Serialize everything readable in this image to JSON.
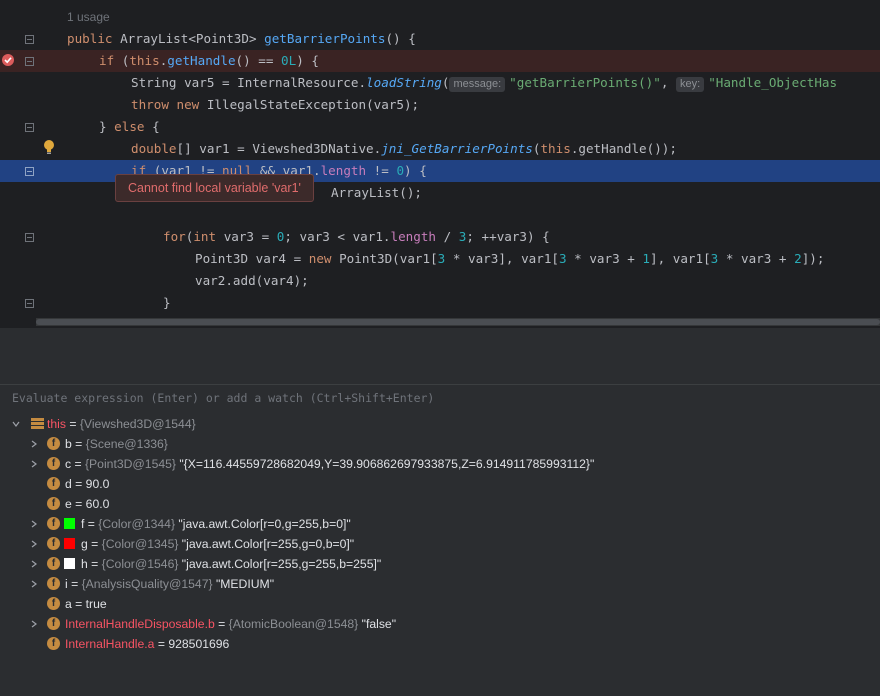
{
  "editor": {
    "usage_label": "1 usage",
    "lines": {
      "l1": {
        "kw1": "public ",
        "type": "ArrayList<Point3D> ",
        "fn": "getBarrierPoints",
        "rest": "() {"
      },
      "l2": {
        "kw1": "if ",
        "p1": "(",
        "kw2": "this",
        "p2": ".",
        "fn": "getHandle",
        "p3": "() == ",
        "num": "0L",
        "p4": ") {"
      },
      "l3": {
        "p1": "String var5 = InternalResource.",
        "fn": "loadString",
        "p2": "(",
        "hint1": "message:",
        "str1": "\"getBarrierPoints()\"",
        "p3": ", ",
        "hint2": "key:",
        "str2": "\"Handle_ObjectHas"
      },
      "l4": {
        "kw1": "throw ",
        "kw2": "new ",
        "p1": "IllegalStateException(var5);"
      },
      "l5": {
        "p1": "} ",
        "kw1": "else ",
        "p2": "{"
      },
      "l6": {
        "kw1": "double",
        "p1": "[] var1 = Viewshed3DNative.",
        "fn": "jni_GetBarrierPoints",
        "p2": "(",
        "kw2": "this",
        "p3": ".getHandle());"
      },
      "l7": {
        "kw1": "if ",
        "p1": "(var1 != ",
        "kw2": "null ",
        "p2": "&& var1.",
        "mem": "length",
        "p3": " != ",
        "num": "0",
        "p4": ") {"
      },
      "l8": {
        "p1": "ArrayList();"
      },
      "l9": {
        "kw1": "for",
        "p1": "(",
        "kw2": "int ",
        "p2": "var3 = ",
        "num1": "0",
        "p3": "; var3 < var1.",
        "mem": "length",
        "p4": " / ",
        "num2": "3",
        "p5": "; ++var3) {"
      },
      "l10": {
        "p1": "Point3D var4 = ",
        "kw1": "new ",
        "p2": "Point3D(var1[",
        "num1": "3",
        "p3": " * var3], var1[",
        "num2": "3",
        "p4": " * var3 + ",
        "num3": "1",
        "p5": "], var1[",
        "num4": "3",
        "p6": " * var3 + ",
        "num5": "2",
        "p7": "]);"
      },
      "l11": {
        "p1": "var2.add(var4);"
      },
      "l12": {
        "p1": "}"
      }
    },
    "tooltip": "Cannot find local variable 'var1'"
  },
  "evaluate": {
    "placeholder": "Evaluate expression (Enter) or add a watch (Ctrl+Shift+Enter)"
  },
  "variables": [
    {
      "name": "this",
      "eq": " = ",
      "ref": "{Viewshed3D@1544}",
      "val": ""
    },
    {
      "name": "b",
      "eq": " = ",
      "ref": "{Scene@1336}",
      "val": ""
    },
    {
      "name": "c",
      "eq": " = ",
      "ref": "{Point3D@1545}",
      "val": " \"{X=116.44559728682049,Y=39.906862697933875,Z=6.914911785993112}\""
    },
    {
      "name": "d",
      "eq": " = ",
      "ref": "",
      "val": "90.0"
    },
    {
      "name": "e",
      "eq": " = ",
      "ref": "",
      "val": "60.0"
    },
    {
      "name": "f",
      "eq": " = ",
      "ref": "{Color@1344}",
      "val": " \"java.awt.Color[r=0,g=255,b=0]\"",
      "color": "#00ff00"
    },
    {
      "name": "g",
      "eq": " = ",
      "ref": "{Color@1345}",
      "val": " \"java.awt.Color[r=255,g=0,b=0]\"",
      "color": "#ff0000"
    },
    {
      "name": "h",
      "eq": " = ",
      "ref": "{Color@1546}",
      "val": " \"java.awt.Color[r=255,g=255,b=255]\"",
      "color": "#ffffff"
    },
    {
      "name": "i",
      "eq": " = ",
      "ref": "{AnalysisQuality@1547}",
      "val": " \"MEDIUM\""
    },
    {
      "name": "a",
      "eq": " = ",
      "ref": "",
      "val": "true"
    },
    {
      "name": "InternalHandleDisposable.b",
      "eq": " = ",
      "ref": "{AtomicBoolean@1548}",
      "val": " \"false\""
    },
    {
      "name": "InternalHandle.a",
      "eq": " = ",
      "ref": "",
      "val": "928501696"
    }
  ]
}
